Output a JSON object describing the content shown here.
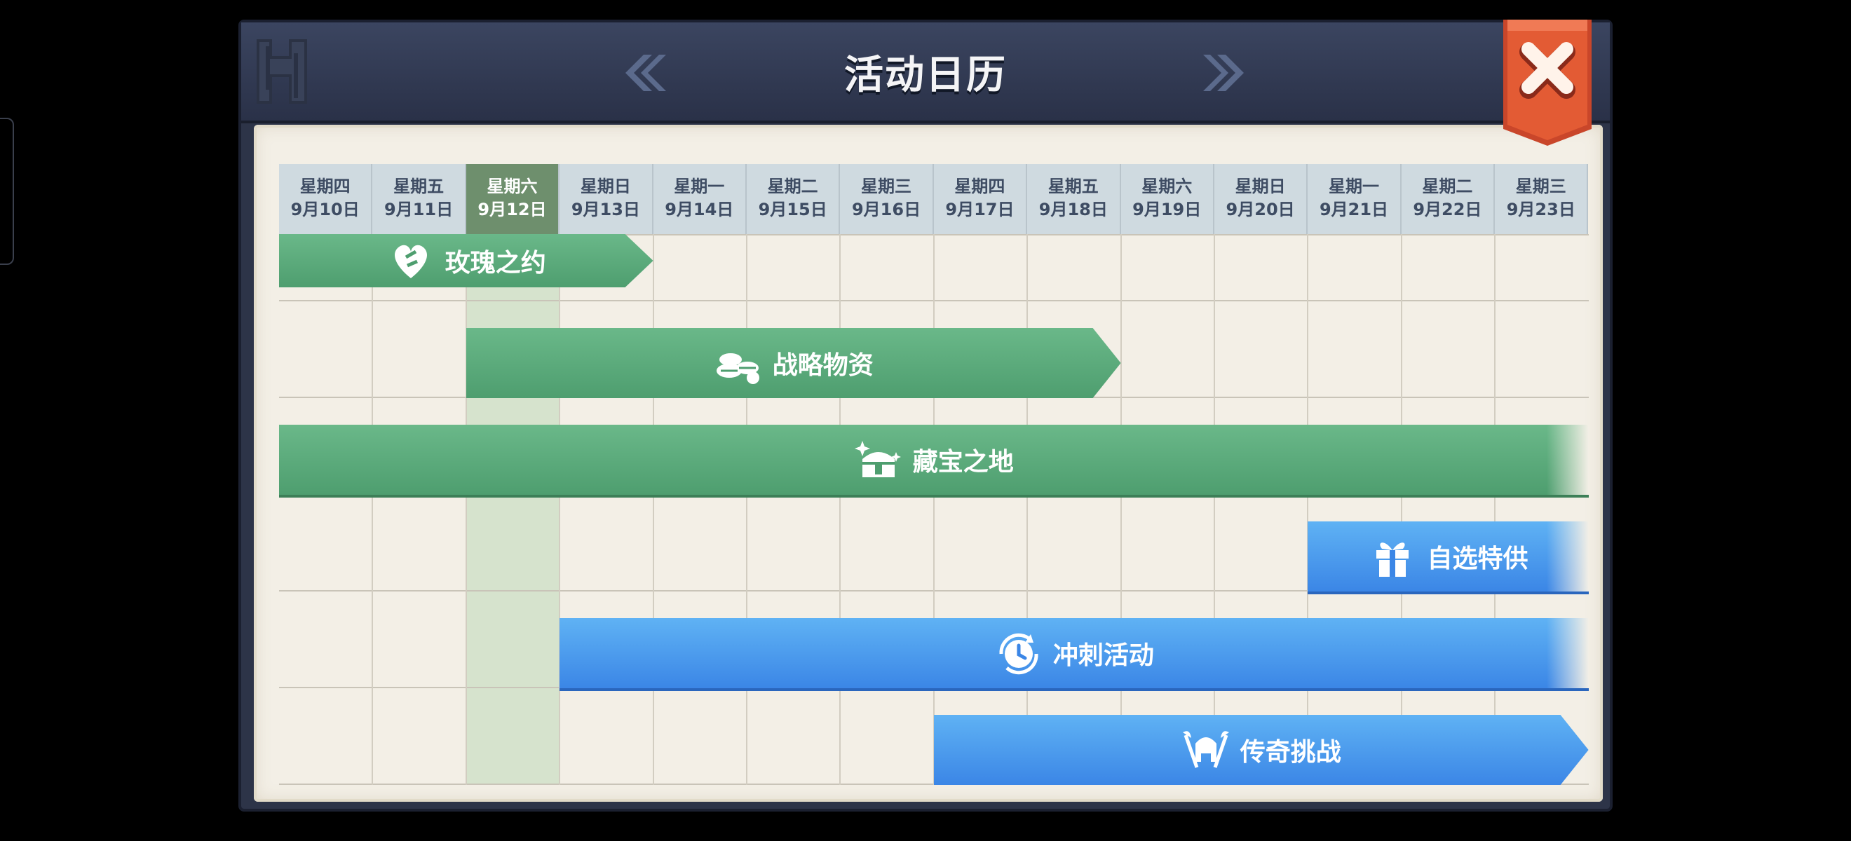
{
  "window": {
    "title": "活动日历"
  },
  "days": [
    {
      "weekday": "星期四",
      "date": "9月10日"
    },
    {
      "weekday": "星期五",
      "date": "9月11日"
    },
    {
      "weekday": "星期六",
      "date": "9月12日",
      "today": true
    },
    {
      "weekday": "星期日",
      "date": "9月13日"
    },
    {
      "weekday": "星期一",
      "date": "9月14日"
    },
    {
      "weekday": "星期二",
      "date": "9月15日"
    },
    {
      "weekday": "星期三",
      "date": "9月16日"
    },
    {
      "weekday": "星期四",
      "date": "9月17日"
    },
    {
      "weekday": "星期五",
      "date": "9月18日"
    },
    {
      "weekday": "星期六",
      "date": "9月19日"
    },
    {
      "weekday": "星期日",
      "date": "9月20日"
    },
    {
      "weekday": "星期一",
      "date": "9月21日"
    },
    {
      "weekday": "星期二",
      "date": "9月22日"
    },
    {
      "weekday": "星期三",
      "date": "9月23日"
    }
  ],
  "events": [
    {
      "name": "玫瑰之约",
      "color": "green",
      "icon": "rose-heart-icon"
    },
    {
      "name": "战略物资",
      "color": "green",
      "icon": "supplies-icon"
    },
    {
      "name": "藏宝之地",
      "color": "green",
      "icon": "treasure-chest-icon"
    },
    {
      "name": "自选特供",
      "color": "blue",
      "icon": "gift-icon"
    },
    {
      "name": "冲刺活动",
      "color": "blue",
      "icon": "clock-refresh-icon"
    },
    {
      "name": "传奇挑战",
      "color": "blue",
      "icon": "helmet-axes-icon"
    }
  ],
  "colors": {
    "green": "#5aa97a",
    "blue": "#4a9bee",
    "today_header": "#6e8f6d",
    "close_button": "#d9512c"
  }
}
